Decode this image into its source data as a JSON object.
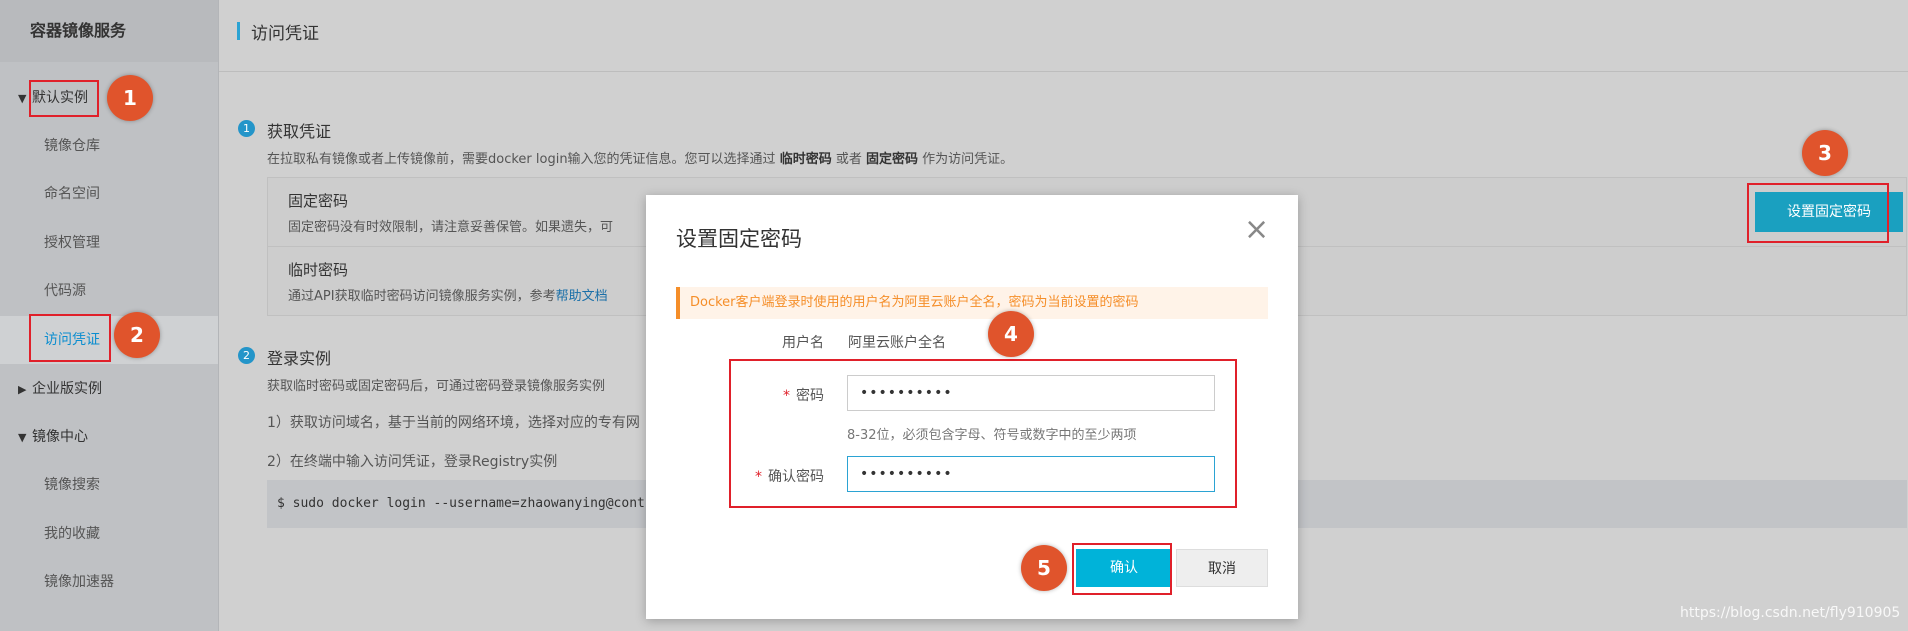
{
  "sidebar": {
    "title": "容器镜像服务",
    "items": [
      {
        "label": "默认实例",
        "caret": "▼"
      },
      {
        "label": "镜像仓库"
      },
      {
        "label": "命名空间"
      },
      {
        "label": "授权管理"
      },
      {
        "label": "代码源"
      },
      {
        "label": "访问凭证"
      },
      {
        "label": "企业版实例",
        "caret": "▶"
      },
      {
        "label": "镜像中心",
        "caret": "▼"
      },
      {
        "label": "镜像搜索"
      },
      {
        "label": "我的收藏"
      },
      {
        "label": "镜像加速器"
      }
    ]
  },
  "header": {
    "title": "访问凭证"
  },
  "step1": {
    "num": "1",
    "title": "获取凭证",
    "desc_pre": "在拉取私有镜像或者上传镜像前，需要docker login输入您的凭证信息。您可以选择通过 ",
    "desc_b1": "临时密码",
    "desc_mid": " 或者 ",
    "desc_b2": "固定密码",
    "desc_post": " 作为访问凭证。",
    "fixed_title": "固定密码",
    "fixed_desc": "固定密码没有时效限制，请注意妥善保管。如果遗失，可",
    "temp_title": "临时密码",
    "temp_desc": "通过API获取临时密码访问镜像服务实例，参考",
    "temp_link": "帮助文档",
    "set_button": "设置固定密码"
  },
  "step2": {
    "num": "2",
    "title": "登录实例",
    "desc": "获取临时密码或固定密码后，可通过密码登录镜像服务实例",
    "line1": "1）获取访问域名，基于当前的网络环境，选择对应的专有网",
    "line2": "2）在终端中输入访问凭证，登录Registry实例",
    "command": "$ sudo docker login --username=zhaowanying@cont"
  },
  "modal": {
    "title": "设置固定密码",
    "close": "×",
    "alert": "Docker客户端登录时使用的用户名为阿里云账户全名，密码为当前设置的密码",
    "username_label": "用户名",
    "username_value": "阿里云账户全名",
    "password_label": "密码",
    "password_value": "••••••••••",
    "password_hint": "8-32位，必须包含字母、符号或数字中的至少两项",
    "confirm_label": "确认密码",
    "confirm_value": "••••••••••",
    "required_mark": "*",
    "ok_button": "确认",
    "cancel_button": "取消"
  },
  "annotations": [
    "1",
    "2",
    "3",
    "4",
    "5"
  ],
  "watermark": "https://blog.csdn.net/fly910905",
  "colors": {
    "accent": "#00b3d9",
    "annotation_red": "#e0202a",
    "badge": "#e0542c",
    "alert": "#f58e29"
  }
}
